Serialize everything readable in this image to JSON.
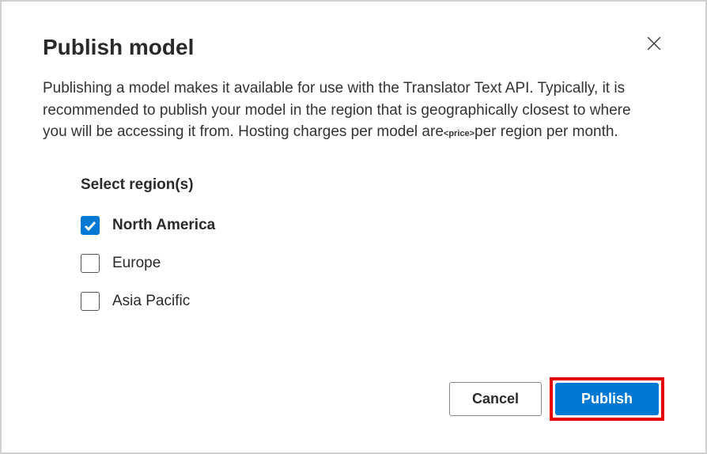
{
  "dialog": {
    "title": "Publish model",
    "description_before": "Publishing a model makes it available for use with the Translator Text API. Typically, it is recommended to publish your model in the region that is geographically closest to where you will be accessing it from. Hosting charges per model are",
    "price_placeholder": "<price>",
    "description_after": "per region per month."
  },
  "regions": {
    "heading": "Select region(s)",
    "items": [
      {
        "label": "North America",
        "checked": true
      },
      {
        "label": "Europe",
        "checked": false
      },
      {
        "label": "Asia Pacific",
        "checked": false
      }
    ]
  },
  "buttons": {
    "cancel": "Cancel",
    "publish": "Publish"
  }
}
